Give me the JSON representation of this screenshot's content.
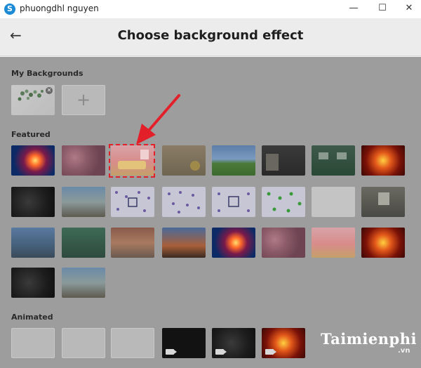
{
  "window": {
    "app_icon_glyph": "S",
    "title": "phuongdhl nguyen",
    "minimize_glyph": "—",
    "maximize_glyph": "☐",
    "close_glyph": "✕"
  },
  "header": {
    "back_glyph": "←",
    "heading": "Choose background effect"
  },
  "sections": {
    "my_backgrounds": "My Backgrounds",
    "featured": "Featured",
    "animated": "Animated"
  },
  "my_backgrounds": {
    "remove_glyph": "✕",
    "add_glyph": "+"
  },
  "featured_tiles": [
    {
      "name": "bg-sunburst-blue-red"
    },
    {
      "name": "bg-pink-blossoms"
    },
    {
      "name": "bg-pink-room"
    },
    {
      "name": "bg-cozy-room"
    },
    {
      "name": "bg-green-hills"
    },
    {
      "name": "bg-dark-room"
    },
    {
      "name": "bg-green-office"
    },
    {
      "name": "bg-red-mandala"
    },
    {
      "name": "bg-dark-mandala"
    },
    {
      "name": "bg-bright-lounge"
    },
    {
      "name": "bg-pattern-purple"
    },
    {
      "name": "bg-pattern-purple-2"
    },
    {
      "name": "bg-pattern-logo"
    },
    {
      "name": "bg-pattern-green"
    },
    {
      "name": "bg-white-wall"
    },
    {
      "name": "bg-gallery-room"
    },
    {
      "name": "bg-blue-lounge"
    },
    {
      "name": "bg-green-lounge"
    },
    {
      "name": "bg-red-loft"
    },
    {
      "name": "bg-sunset-terrace"
    },
    {
      "name": "bg-sunburst-blue-red-2"
    },
    {
      "name": "bg-pink-blossoms-2"
    },
    {
      "name": "bg-pink-room-2"
    },
    {
      "name": "bg-red-mandala-2"
    },
    {
      "name": "bg-dark-mandala-2"
    },
    {
      "name": "bg-bright-lounge-2"
    }
  ],
  "animated_tiles": [
    {
      "name": "anim-empty-1"
    },
    {
      "name": "anim-empty-2"
    },
    {
      "name": "anim-empty-3"
    },
    {
      "name": "anim-dark"
    },
    {
      "name": "anim-dark-mandala"
    },
    {
      "name": "anim-red-mandala"
    }
  ],
  "colors": {
    "highlight": "#e3202a",
    "arrow": "#e3202a",
    "overlay": "#9d9d9d"
  },
  "watermark": {
    "logo_initial": "T",
    "logo_rest": "aimienphi",
    "suffix": ".vn"
  }
}
